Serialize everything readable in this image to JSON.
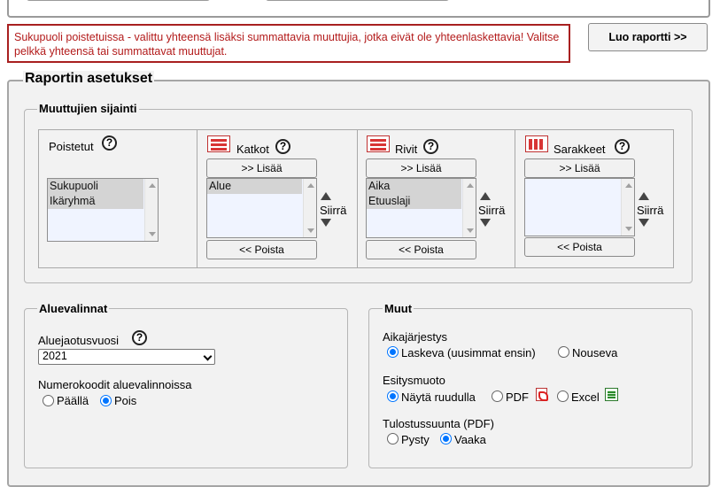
{
  "error_message": "Sukupuoli poistetuissa - valittu yhteensä lisäksi summattavia muuttujia, jotka eivät ole yhteenlaskettavia! Valitse pelkkä yhteensä tai summattavat muuttujat.",
  "report_button": "Luo raportti >>",
  "report_settings": {
    "legend": "Raportin asetukset",
    "variables": {
      "legend": "Muuttujien sijainti",
      "move_label": "Siirrä",
      "add_label": ">> Lisää",
      "remove_label": "<< Poista",
      "help_icon": "?",
      "columns": [
        {
          "title": "Poistetut",
          "icon": "",
          "items": [
            "Sukupuoli",
            "Ikäryhmä"
          ]
        },
        {
          "title": "Katkot",
          "icon": "katkot-table-icon",
          "items": [
            "Alue"
          ]
        },
        {
          "title": "Rivit",
          "icon": "rows-table-icon",
          "items": [
            "Aika",
            "Etuuslaji"
          ]
        },
        {
          "title": "Sarakkeet",
          "icon": "columns-table-icon",
          "items": []
        }
      ]
    },
    "region": {
      "legend": "Aluevalinnat",
      "year_label": "Aluejaotusvuosi",
      "year_value": "2021",
      "numcodes_label": "Numerokoodit aluevalinnoissa",
      "on_label": "Päällä",
      "off_label": "Pois",
      "numcodes_selected": "Pois"
    },
    "other": {
      "legend": "Muut",
      "order_label": "Aikajärjestys",
      "order_desc": "Laskeva (uusimmat ensin)",
      "order_asc": "Nouseva",
      "order_selected": "Laskeva (uusimmat ensin)",
      "format_label": "Esitysmuoto",
      "format_screen": "Näytä ruudulla",
      "format_pdf": "PDF",
      "format_excel": "Excel",
      "format_selected": "Näytä ruudulla",
      "orient_label": "Tulostussuunta (PDF)",
      "orient_portrait": "Pysty",
      "orient_landscape": "Vaaka",
      "orient_selected": "Vaaka"
    }
  },
  "colors": {
    "error": "#b31b1b",
    "radio_selected": "#0075ff",
    "fieldset_bg": "#f2f2f2",
    "table_icon_red": "#d83434"
  }
}
